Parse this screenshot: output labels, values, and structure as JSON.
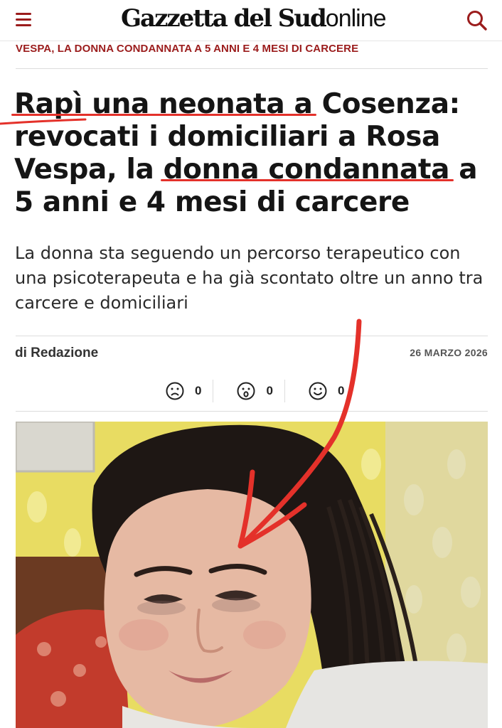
{
  "header": {
    "logo_main": "Gazzetta del Sud",
    "logo_sub": "online",
    "menu_icon": "hamburger-menu-icon",
    "search_icon": "search-icon"
  },
  "article": {
    "kicker": "VESPA, LA DONNA CONDANNATA A 5 ANNI E 4 MESI DI CARCERE",
    "headline_parts": {
      "p1": "Rapì una neonata a",
      "p2": " Cosenza: revocati i domiciliari a Rosa Vespa, la ",
      "p3": "donna condannata",
      "p4": " a 5 anni e 4 mesi di carcere"
    },
    "subtitle": "La donna sta seguendo un percorso terapeutico con una psicoterapeuta e ha già scontato oltre un anno tra carcere e domiciliari",
    "author": "di Redazione",
    "date": "26 MARZO 2026",
    "reactions": [
      {
        "icon": "sad-face-icon",
        "count": "0"
      },
      {
        "icon": "surprised-face-icon",
        "count": "0"
      },
      {
        "icon": "happy-face-icon",
        "count": "0"
      }
    ]
  },
  "colors": {
    "brand_red": "#9b1c1c",
    "highlight_yellow": "#f2f13a",
    "annotation_red": "#e4312a"
  }
}
